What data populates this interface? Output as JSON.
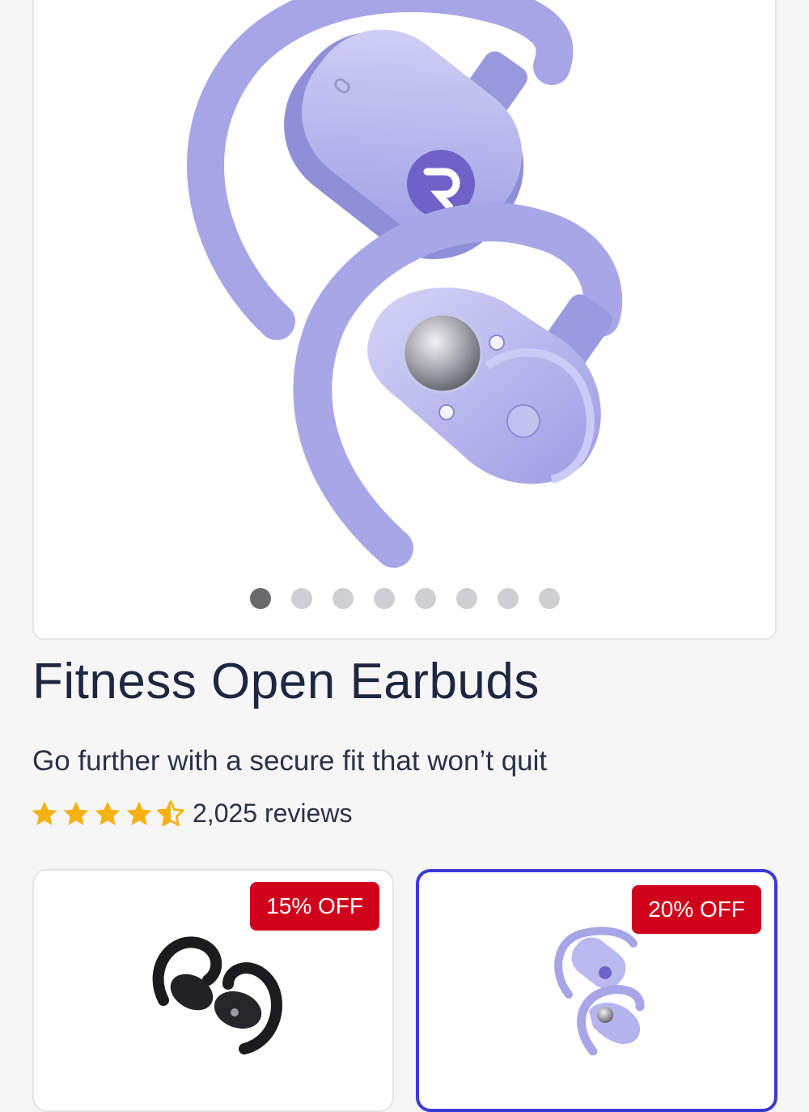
{
  "product": {
    "title": "Fitness Open Earbuds",
    "subtitle": "Go further with a secure fit that won’t quit",
    "rating": 4.5,
    "reviews_text": "2,025 reviews"
  },
  "gallery": {
    "dot_count": 8,
    "active_index": 0
  },
  "variants": [
    {
      "color_name": "black",
      "badge": "15% OFF",
      "selected": false
    },
    {
      "color_name": "lavender",
      "badge": "20% OFF",
      "selected": true
    }
  ],
  "colors": {
    "star": "#f5b10f",
    "badge": "#d0021b",
    "selected_border": "#3a3ad6",
    "earbud_lavender": "#a9a9ea",
    "earbud_black": "#1c1c1e"
  },
  "icons": [
    "earbuds-product-image",
    "star-icon",
    "star-half-icon"
  ]
}
